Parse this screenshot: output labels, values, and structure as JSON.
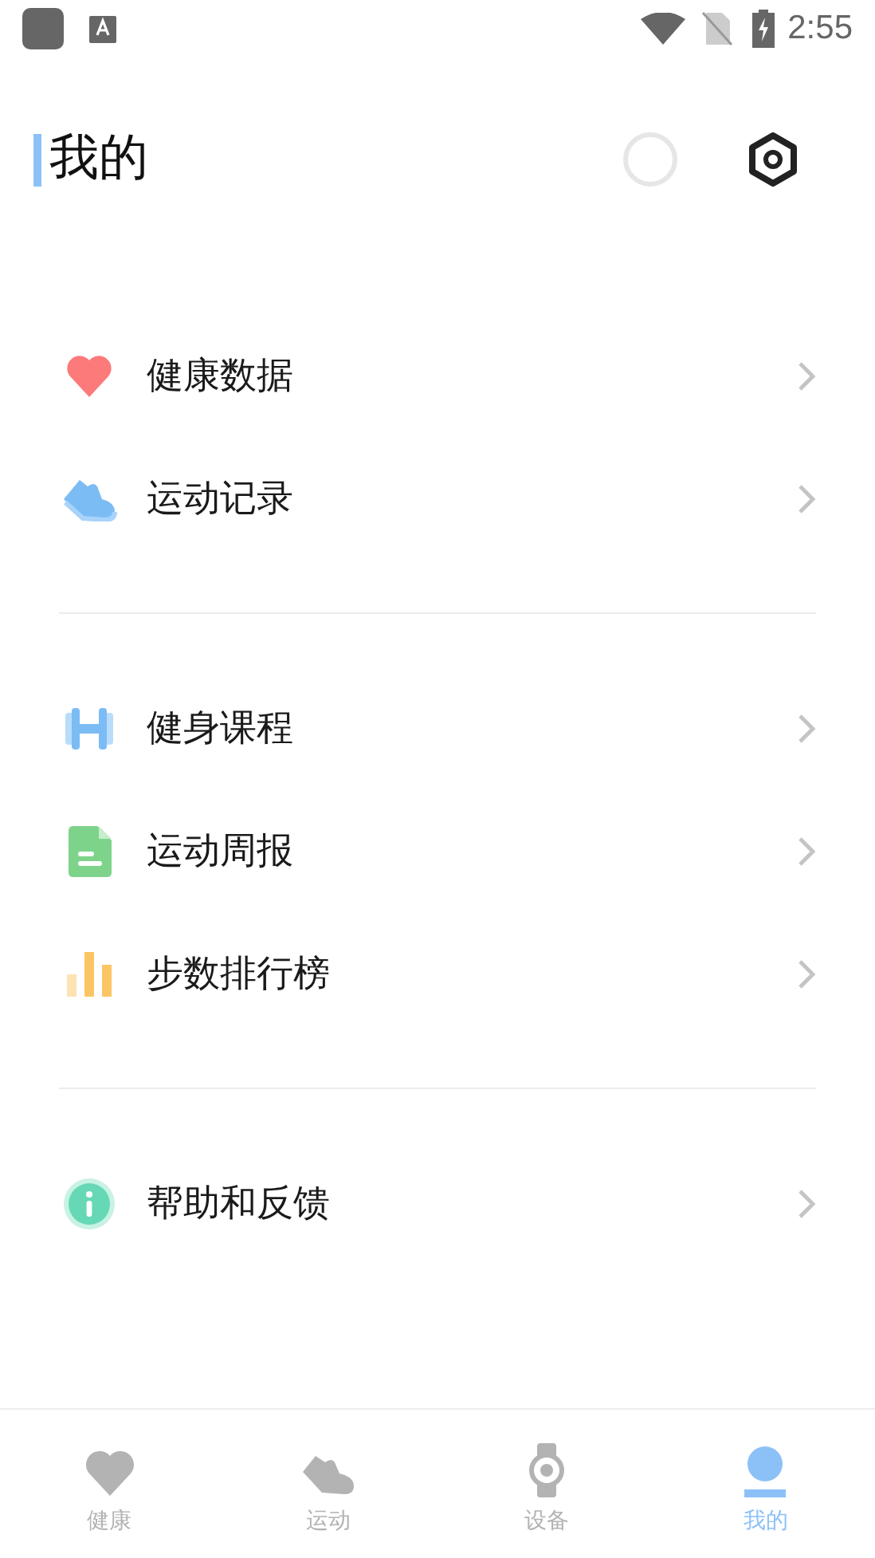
{
  "status_bar": {
    "time": "2:55"
  },
  "header": {
    "title": "我的"
  },
  "groups": [
    {
      "items": [
        {
          "label": "健康数据"
        },
        {
          "label": "运动记录"
        }
      ]
    },
    {
      "items": [
        {
          "label": "健身课程"
        },
        {
          "label": "运动周报"
        },
        {
          "label": "步数排行榜"
        }
      ]
    },
    {
      "items": [
        {
          "label": "帮助和反馈"
        }
      ]
    }
  ],
  "tabs": [
    {
      "label": "健康",
      "selected": false
    },
    {
      "label": "运动",
      "selected": false
    },
    {
      "label": "设备",
      "selected": false
    },
    {
      "label": "我的",
      "selected": true
    }
  ]
}
